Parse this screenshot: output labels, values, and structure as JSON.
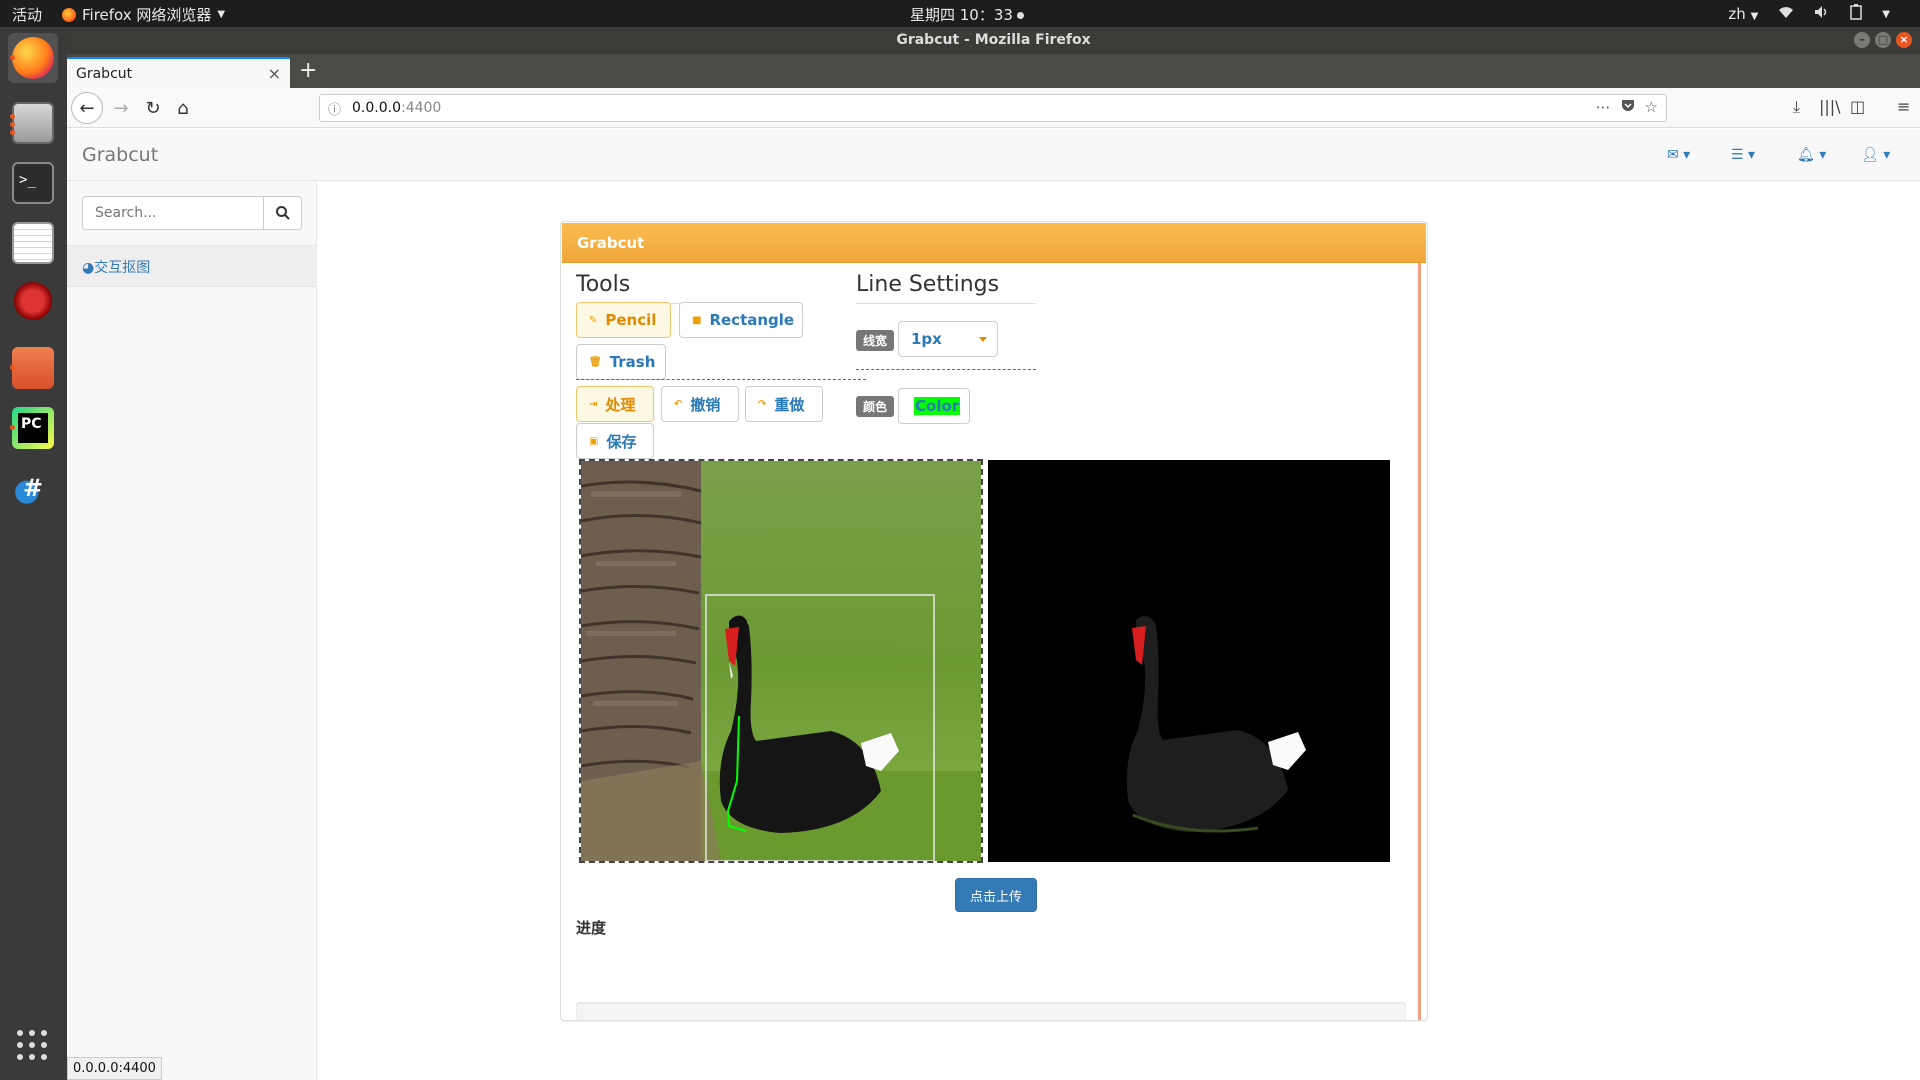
{
  "topbar": {
    "activities": "活动",
    "app_menu": "Firefox 网络浏览器",
    "clock": "星期四 10：33",
    "lang": "zh"
  },
  "window": {
    "title": "Grabcut - Mozilla Firefox"
  },
  "tab": {
    "label": "Grabcut"
  },
  "url": {
    "host": "0.0.0.0",
    "port": ":4400"
  },
  "page": {
    "brand": "Grabcut",
    "search_placeholder": "Search...",
    "menu_item": "交互抠图"
  },
  "panel": {
    "heading": "Grabcut",
    "tools_title": "Tools",
    "line_settings_title": "Line Settings",
    "buttons": {
      "pencil": "Pencil",
      "rectangle": "Rectangle",
      "trash": "Trash",
      "process": "处理",
      "undo": "撤销",
      "redo": "重做",
      "save": "保存"
    },
    "line_width_label": "线宽",
    "line_width_value": "1px",
    "color_label": "颜色",
    "color_button": "Color",
    "color_value": "#00ff00",
    "upload": "点击上传",
    "progress_label": "进度"
  },
  "colors": {
    "accent": "#f0a63b",
    "primary": "#337ab7",
    "ubuntu_orange": "#e95420"
  },
  "status_url": "0.0.0.0:4400"
}
